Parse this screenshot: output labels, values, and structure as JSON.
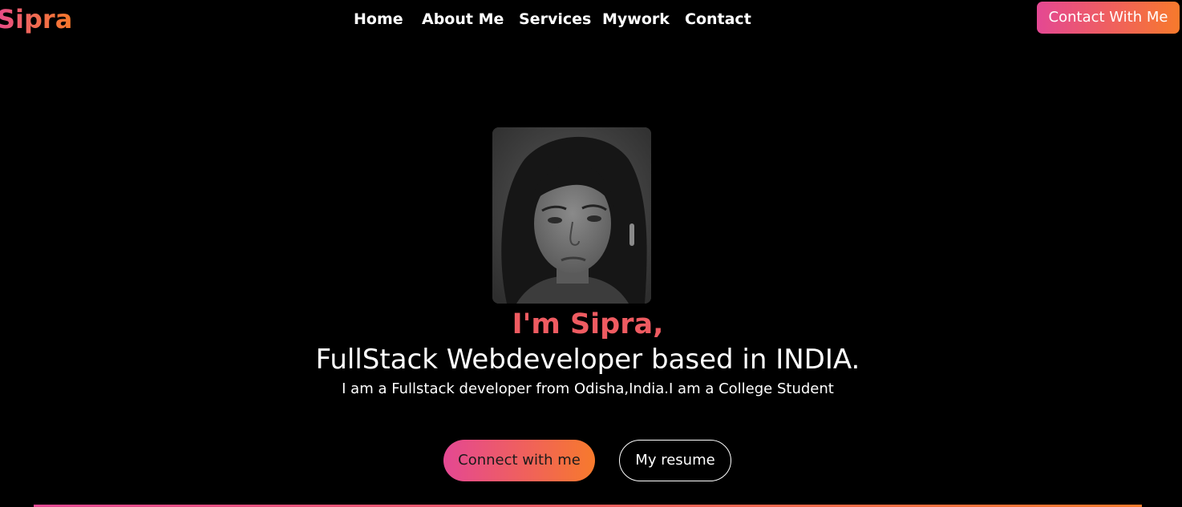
{
  "header": {
    "logo": "Sipra",
    "nav": [
      {
        "label": "Home"
      },
      {
        "label": "About Me"
      },
      {
        "label": "Services"
      },
      {
        "label": "Mywork"
      },
      {
        "label": "Contact"
      }
    ],
    "cta_label": "Contact With Me"
  },
  "hero": {
    "greeting": "I'm Sipra,",
    "title": "FullStack Webdeveloper based in INDIA.",
    "subtitle": "I am a Fullstack developer from Odisha,India.I am a College Student",
    "primary_button": "Connect with me",
    "secondary_button": "My resume"
  },
  "colors": {
    "background": "#000000",
    "accent_pink": "#e44893",
    "accent_orange": "#f77a2c",
    "greeting": "#ef5b61",
    "text": "#ffffff"
  }
}
